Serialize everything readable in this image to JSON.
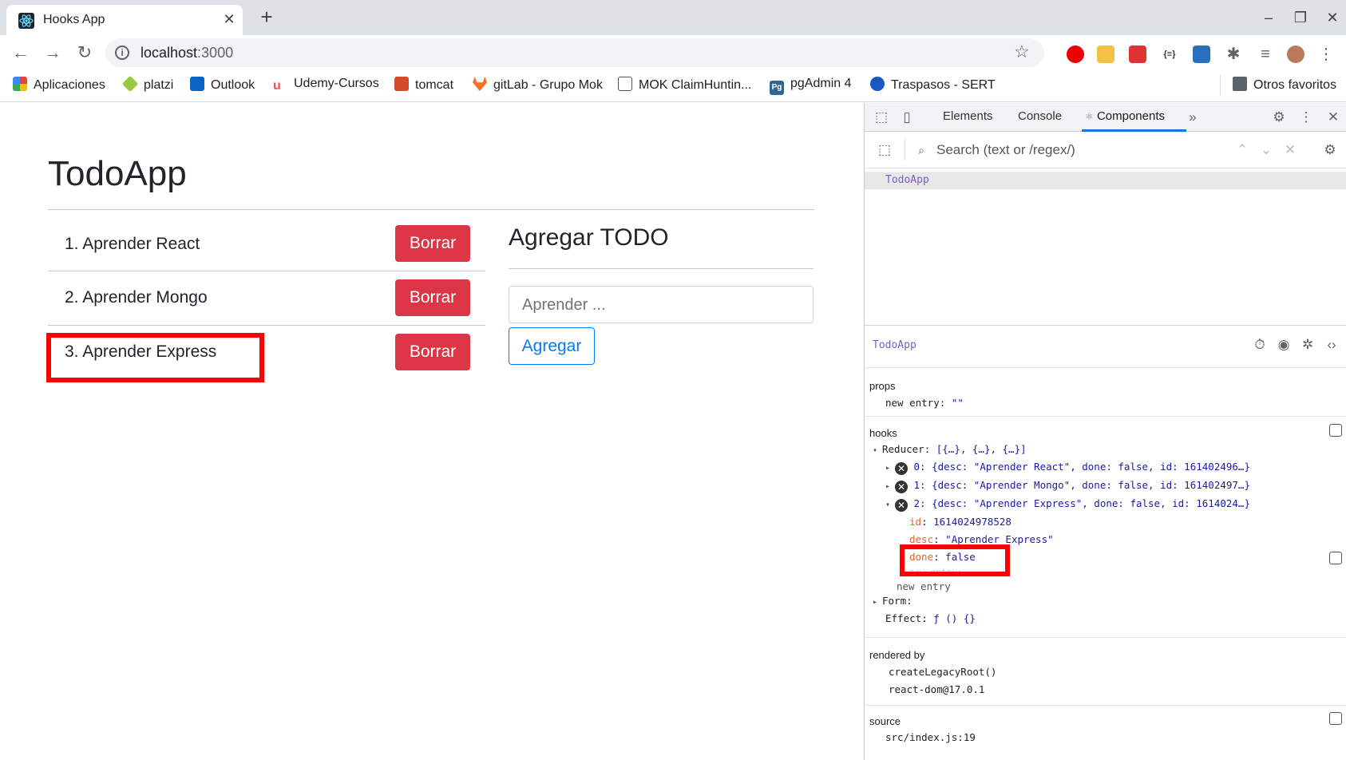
{
  "browser": {
    "tab_title": "Hooks App",
    "tab_close": "✕",
    "new_tab": "+",
    "url_host": "localhost",
    "url_port": ":3000",
    "bookmarks": [
      "Aplicaciones",
      "platzi",
      "Outlook",
      "Udemy-Cursos",
      "tomcat",
      "gitLab - Grupo Mok",
      "MOK ClaimHuntin...",
      "pgAdmin 4",
      "Traspasos - SERT"
    ],
    "other_bookmarks": "Otros favoritos"
  },
  "app": {
    "title": "TodoApp",
    "todos": [
      "1. Aprender React",
      "2. Aprender Mongo",
      "3. Aprender Express"
    ],
    "delete_label": "Borrar",
    "add_title": "Agregar TODO",
    "input_placeholder": "Aprender ...",
    "add_button": "Agregar"
  },
  "devtools": {
    "tabs": [
      "Elements",
      "Console",
      "Components"
    ],
    "search_placeholder": "Search (text or /regex/)",
    "tree_selected": "TodoApp",
    "component_name": "TodoApp",
    "props_label": "props",
    "props_line": {
      "key": "new entry",
      "value": "\"\""
    },
    "hooks_label": "hooks",
    "reducer": {
      "name": "Reducer",
      "value": "[{…}, {…}, {…}]"
    },
    "reducer_items": [
      "0: {desc: \"Aprender React\", done: false, id: 161402496…}",
      "1: {desc: \"Aprender Mongo\", done: false, id: 161402497…}",
      "2: {desc: \"Aprender Express\", done: false, id: 1614024…}"
    ],
    "expanded": {
      "id_key": "id",
      "id_val": "1614024978528",
      "desc_key": "desc",
      "desc_val": "\"Aprender Express\"",
      "done_key": "done",
      "done_val": "false"
    },
    "new_entry_faded": "new entry:",
    "new_entry": "new entry",
    "form_label": "Form:",
    "effect_label": "Effect:",
    "effect_val": "ƒ () {}",
    "rendered_by_label": "rendered by",
    "rendered_by": [
      "createLegacyRoot()",
      "react-dom@17.0.1"
    ],
    "source_label": "source",
    "source_val": "src/index.js:19"
  }
}
